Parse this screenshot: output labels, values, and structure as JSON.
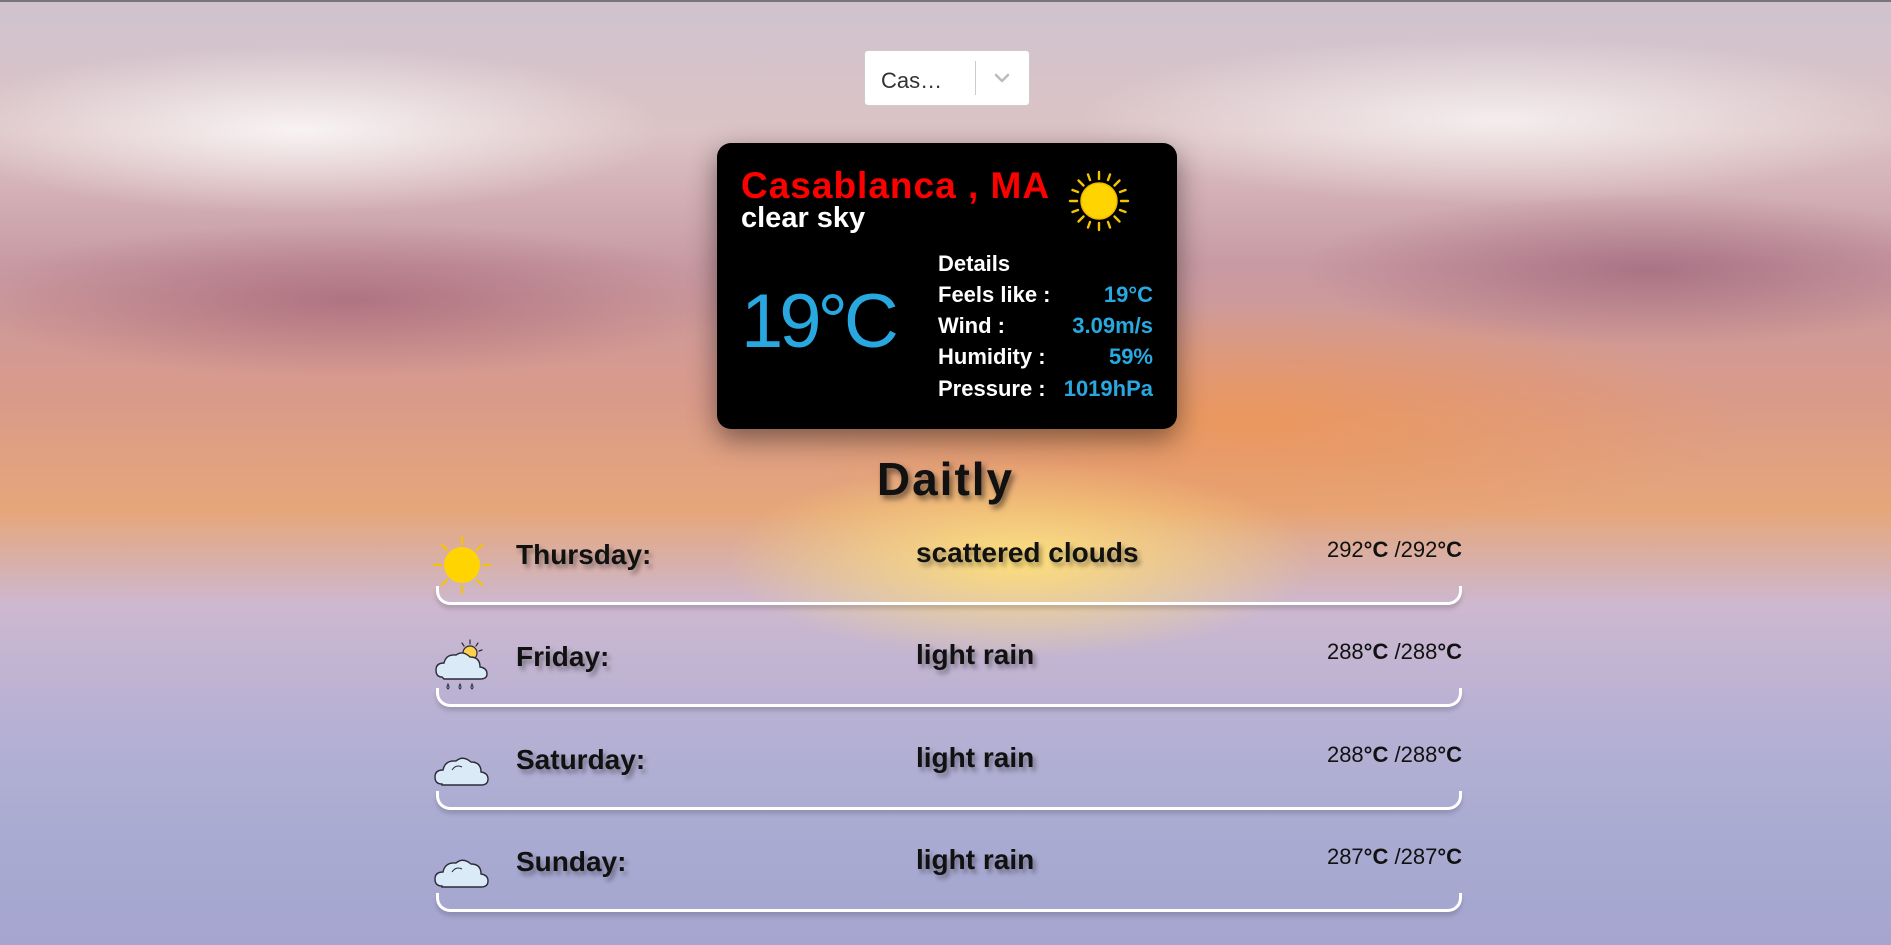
{
  "city_select": {
    "value": "Cas…"
  },
  "current": {
    "city": "Casablanca , MA",
    "description": "clear sky",
    "temperature": "19°C",
    "icon": "sun-icon",
    "details_title": "Details",
    "details": [
      {
        "label": "Feels like :",
        "value": "19°C"
      },
      {
        "label": "Wind :",
        "value": "3.09m/s"
      },
      {
        "label": "Humidity :",
        "value": "59%"
      },
      {
        "label": "Pressure :",
        "value": "1019hPa"
      }
    ]
  },
  "daily": {
    "heading": "Daitly",
    "items": [
      {
        "day": "Thursday:",
        "condition": "scattered clouds",
        "min": "292",
        "max": "292",
        "unit": "°C",
        "icon": "sun-icon"
      },
      {
        "day": "Friday:",
        "condition": "light rain",
        "min": "288",
        "max": "288",
        "unit": "°C",
        "icon": "sun-rain-cloud-icon"
      },
      {
        "day": "Saturday:",
        "condition": "light rain",
        "min": "288",
        "max": "288",
        "unit": "°C",
        "icon": "cloud-icon"
      },
      {
        "day": "Sunday:",
        "condition": "light rain",
        "min": "287",
        "max": "287",
        "unit": "°C",
        "icon": "cloud-icon"
      }
    ]
  },
  "colors": {
    "accent": "#29a8e0",
    "city": "#ff0000",
    "card_bg": "#000000"
  }
}
